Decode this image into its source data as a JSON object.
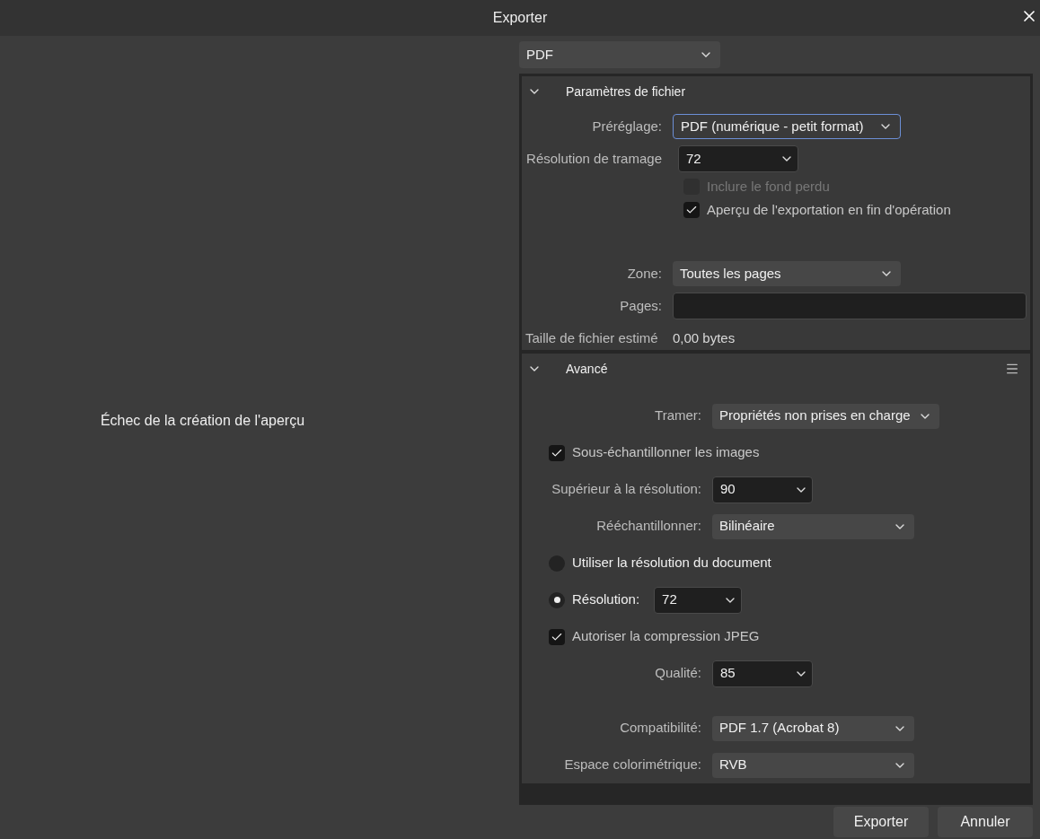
{
  "window": {
    "title": "Exporter"
  },
  "preview": {
    "message": "Échec de la création de l'aperçu"
  },
  "format": {
    "value": "PDF"
  },
  "sections": [
    {
      "title": "Paramètres de fichier",
      "expanded": true,
      "menu": false,
      "groups": [
        [
          {
            "kind": "dropdown",
            "label": "Préréglage:",
            "value": "PDF (numérique - petit format)",
            "focused": true
          },
          {
            "kind": "combo",
            "label": "Résolution de tramage",
            "value": "72"
          },
          {
            "kind": "checkbox",
            "label": "Inclure le fond perdu",
            "checked": false,
            "disabled": true
          },
          {
            "kind": "checkbox",
            "label": "Aperçu de l'exportation en fin d'opération",
            "checked": true,
            "disabled": false
          }
        ],
        [
          {
            "kind": "dropdown",
            "label": "Zone:",
            "value": "Toutes les pages",
            "focused": false
          },
          {
            "kind": "input",
            "label": "Pages:"
          },
          {
            "kind": "info",
            "label": "Taille de fichier estimé",
            "value": "0,00 bytes"
          }
        ]
      ]
    },
    {
      "title": "Avancé",
      "expanded": true,
      "menu": true,
      "groups": [
        [
          {
            "kind": "dropdown",
            "label": "Tramer:",
            "value": "Propriétés non prises en charge",
            "focused": false
          },
          {
            "kind": "checkbox",
            "label": "Sous-échantillonner les images",
            "checked": true,
            "disabled": false
          },
          {
            "kind": "combo",
            "label": "Supérieur à la résolution:",
            "value": "90"
          },
          {
            "kind": "dropdown",
            "label": "Rééchantillonner:",
            "value": "Bilinéaire",
            "focused": false
          },
          {
            "kind": "radio",
            "label": "Utiliser la résolution du document",
            "selected": false
          },
          {
            "kind": "radio",
            "label": "Résolution:",
            "selected": true,
            "value": "72"
          },
          {
            "kind": "checkbox",
            "label": "Autoriser la compression JPEG",
            "checked": true,
            "disabled": false
          },
          {
            "kind": "combo",
            "label": "Qualité:",
            "value": "85"
          }
        ],
        [
          {
            "kind": "dropdown",
            "label": "Compatibilité:",
            "value": "PDF 1.7 (Acrobat 8)",
            "focused": false
          },
          {
            "kind": "dropdown",
            "label": "Espace colorimétrique:",
            "value": "RVB",
            "focused": false
          }
        ]
      ]
    }
  ],
  "buttons": [
    {
      "label": "Exporter"
    },
    {
      "label": "Annuler"
    }
  ]
}
